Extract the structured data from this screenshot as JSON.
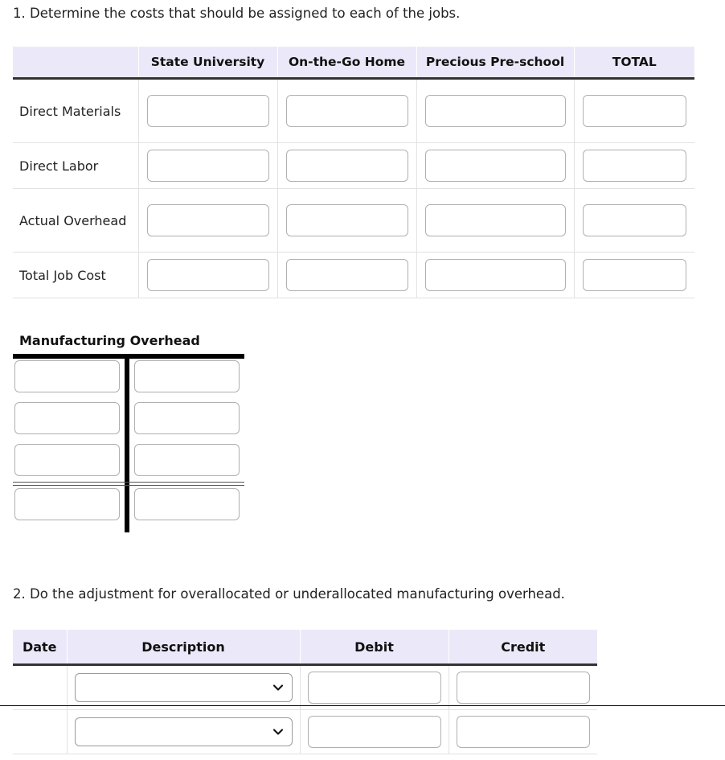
{
  "prompts": {
    "q1": "1. Determine the costs that should be assigned to each of the jobs.",
    "q2": "2. Do the adjustment for overallocated or underallocated manufacturing overhead."
  },
  "job_cost_table": {
    "headers": [
      "",
      "State University",
      "On-the-Go Home",
      "Precious Pre-school",
      "TOTAL"
    ],
    "row_labels": [
      "Direct Materials",
      "Direct Labor",
      "Actual Overhead",
      "Total Job Cost"
    ],
    "cell_values": [
      [
        "",
        "",
        "",
        ""
      ],
      [
        "",
        "",
        "",
        ""
      ],
      [
        "",
        "",
        "",
        ""
      ],
      [
        "",
        "",
        "",
        ""
      ]
    ],
    "input_placeholder": ""
  },
  "t_account": {
    "title": "Manufacturing Overhead",
    "debit_values": [
      "",
      "",
      "",
      ""
    ],
    "credit_values": [
      "",
      "",
      "",
      ""
    ]
  },
  "journal_table": {
    "headers": [
      "Date",
      "Description",
      "Debit",
      "Credit"
    ],
    "rows": [
      {
        "date": "",
        "description": "",
        "debit": "",
        "credit": ""
      },
      {
        "date": "",
        "description": "",
        "debit": "",
        "credit": ""
      }
    ],
    "description_options": [
      ""
    ]
  },
  "colors": {
    "header_background": "#ebe9f9",
    "header_rule": "#333333",
    "rule_black": "#000000",
    "input_border": "#b0b0b0",
    "text": "#222222"
  },
  "icons": {
    "chevron_down": "chevron-down-icon"
  }
}
